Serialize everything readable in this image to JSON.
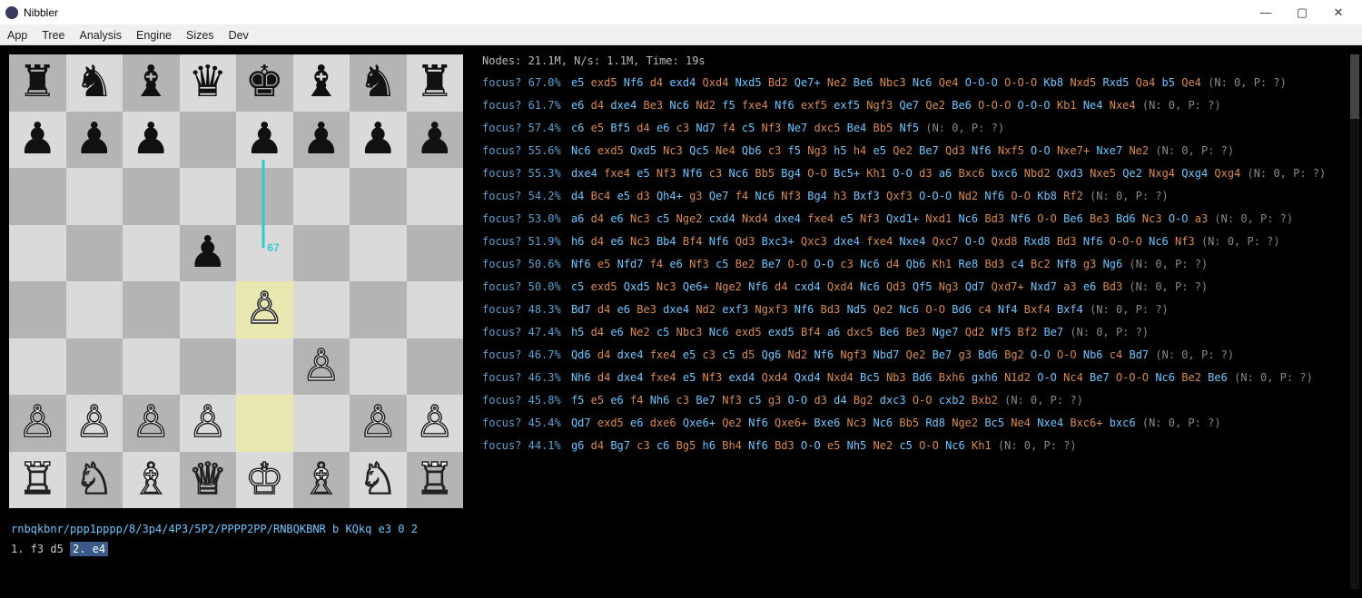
{
  "window": {
    "title": "Nibbler",
    "min_glyph": "—",
    "max_glyph": "▢",
    "close_glyph": "✕"
  },
  "menu": [
    "App",
    "Tree",
    "Analysis",
    "Engine",
    "Sizes",
    "Dev"
  ],
  "board": {
    "fen": "rnbqkbnr/ppp1pppp/8/3p4/4P3/5P2/PPPP2PP/RNBQKBNR b KQkq e3 0 2",
    "moves_prefix": "1. f3 d5 ",
    "current_move": "2. e4",
    "arrow_label": "67",
    "highlights": [
      "e4",
      "e2"
    ],
    "pieces": [
      {
        "sq": "a8",
        "g": "♜",
        "c": "black"
      },
      {
        "sq": "b8",
        "g": "♞",
        "c": "black"
      },
      {
        "sq": "c8",
        "g": "♝",
        "c": "black"
      },
      {
        "sq": "d8",
        "g": "♛",
        "c": "black"
      },
      {
        "sq": "e8",
        "g": "♚",
        "c": "black"
      },
      {
        "sq": "f8",
        "g": "♝",
        "c": "black"
      },
      {
        "sq": "g8",
        "g": "♞",
        "c": "black"
      },
      {
        "sq": "h8",
        "g": "♜",
        "c": "black"
      },
      {
        "sq": "a7",
        "g": "♟",
        "c": "black"
      },
      {
        "sq": "b7",
        "g": "♟",
        "c": "black"
      },
      {
        "sq": "c7",
        "g": "♟",
        "c": "black"
      },
      {
        "sq": "e7",
        "g": "♟",
        "c": "black"
      },
      {
        "sq": "f7",
        "g": "♟",
        "c": "black"
      },
      {
        "sq": "g7",
        "g": "♟",
        "c": "black"
      },
      {
        "sq": "h7",
        "g": "♟",
        "c": "black"
      },
      {
        "sq": "d5",
        "g": "♟",
        "c": "black"
      },
      {
        "sq": "e4",
        "g": "♙",
        "c": "white"
      },
      {
        "sq": "f3",
        "g": "♙",
        "c": "white"
      },
      {
        "sq": "a2",
        "g": "♙",
        "c": "white"
      },
      {
        "sq": "b2",
        "g": "♙",
        "c": "white"
      },
      {
        "sq": "c2",
        "g": "♙",
        "c": "white"
      },
      {
        "sq": "d2",
        "g": "♙",
        "c": "white"
      },
      {
        "sq": "g2",
        "g": "♙",
        "c": "white"
      },
      {
        "sq": "h2",
        "g": "♙",
        "c": "white"
      },
      {
        "sq": "a1",
        "g": "♖",
        "c": "white"
      },
      {
        "sq": "b1",
        "g": "♘",
        "c": "white"
      },
      {
        "sq": "c1",
        "g": "♗",
        "c": "white"
      },
      {
        "sq": "d1",
        "g": "♕",
        "c": "white"
      },
      {
        "sq": "e1",
        "g": "♔",
        "c": "white"
      },
      {
        "sq": "f1",
        "g": "♗",
        "c": "white"
      },
      {
        "sq": "g1",
        "g": "♘",
        "c": "white"
      },
      {
        "sq": "h1",
        "g": "♖",
        "c": "white"
      }
    ]
  },
  "status": "Nodes: 21.1M, N/s: 1.1M, Time: 19s",
  "label": "focus?",
  "lines": [
    {
      "pct": "67.0%",
      "moves": [
        "e5",
        "exd5",
        "Nf6",
        "d4",
        "exd4",
        "Qxd4",
        "Nxd5",
        "Bd2",
        "Qe7+",
        "Ne2",
        "Be6",
        "Nbc3",
        "Nc6",
        "Qe4",
        "O-O-O",
        "O-O-O",
        "Kb8",
        "Nxd5",
        "Rxd5",
        "Qa4",
        "b5",
        "Qe4"
      ],
      "np": "(N: 0, P: ?)"
    },
    {
      "pct": "61.7%",
      "moves": [
        "e6",
        "d4",
        "dxe4",
        "Be3",
        "Nc6",
        "Nd2",
        "f5",
        "fxe4",
        "Nf6",
        "exf5",
        "exf5",
        "Ngf3",
        "Qe7",
        "Qe2",
        "Be6",
        "O-O-O",
        "O-O-O",
        "Kb1",
        "Ne4",
        "Nxe4"
      ],
      "np": "(N: 0, P: ?)"
    },
    {
      "pct": "57.4%",
      "moves": [
        "c6",
        "e5",
        "Bf5",
        "d4",
        "e6",
        "c3",
        "Nd7",
        "f4",
        "c5",
        "Nf3",
        "Ne7",
        "dxc5",
        "Be4",
        "Bb5",
        "Nf5"
      ],
      "np": "(N: 0, P: ?)"
    },
    {
      "pct": "55.6%",
      "moves": [
        "Nc6",
        "exd5",
        "Qxd5",
        "Nc3",
        "Qc5",
        "Ne4",
        "Qb6",
        "c3",
        "f5",
        "Ng3",
        "h5",
        "h4",
        "e5",
        "Qe2",
        "Be7",
        "Qd3",
        "Nf6",
        "Nxf5",
        "O-O",
        "Nxe7+",
        "Nxe7",
        "Ne2"
      ],
      "np": "(N: 0, P: ?)"
    },
    {
      "pct": "55.3%",
      "moves": [
        "dxe4",
        "fxe4",
        "e5",
        "Nf3",
        "Nf6",
        "c3",
        "Nc6",
        "Bb5",
        "Bg4",
        "O-O",
        "Bc5+",
        "Kh1",
        "O-O",
        "d3",
        "a6",
        "Bxc6",
        "bxc6",
        "Nbd2",
        "Qxd3",
        "Nxe5",
        "Qe2",
        "Nxg4",
        "Qxg4",
        "Qxg4"
      ],
      "np": "(N: 0, P: ?)"
    },
    {
      "pct": "54.2%",
      "moves": [
        "d4",
        "Bc4",
        "e5",
        "d3",
        "Qh4+",
        "g3",
        "Qe7",
        "f4",
        "Nc6",
        "Nf3",
        "Bg4",
        "h3",
        "Bxf3",
        "Qxf3",
        "O-O-O",
        "Nd2",
        "Nf6",
        "O-O",
        "Kb8",
        "Rf2"
      ],
      "np": "(N: 0, P: ?)"
    },
    {
      "pct": "53.0%",
      "moves": [
        "a6",
        "d4",
        "e6",
        "Nc3",
        "c5",
        "Nge2",
        "cxd4",
        "Nxd4",
        "dxe4",
        "fxe4",
        "e5",
        "Nf3",
        "Qxd1+",
        "Nxd1",
        "Nc6",
        "Bd3",
        "Nf6",
        "O-O",
        "Be6",
        "Be3",
        "Bd6",
        "Nc3",
        "O-O",
        "a3"
      ],
      "np": "(N: 0, P: ?)"
    },
    {
      "pct": "51.9%",
      "moves": [
        "h6",
        "d4",
        "e6",
        "Nc3",
        "Bb4",
        "Bf4",
        "Nf6",
        "Qd3",
        "Bxc3+",
        "Qxc3",
        "dxe4",
        "fxe4",
        "Nxe4",
        "Qxc7",
        "O-O",
        "Qxd8",
        "Rxd8",
        "Bd3",
        "Nf6",
        "O-O-O",
        "Nc6",
        "Nf3"
      ],
      "np": "(N: 0, P: ?)"
    },
    {
      "pct": "50.6%",
      "moves": [
        "Nf6",
        "e5",
        "Nfd7",
        "f4",
        "e6",
        "Nf3",
        "c5",
        "Be2",
        "Be7",
        "O-O",
        "O-O",
        "c3",
        "Nc6",
        "d4",
        "Qb6",
        "Kh1",
        "Re8",
        "Bd3",
        "c4",
        "Bc2",
        "Nf8",
        "g3",
        "Ng6"
      ],
      "np": "(N: 0, P: ?)"
    },
    {
      "pct": "50.0%",
      "moves": [
        "c5",
        "exd5",
        "Qxd5",
        "Nc3",
        "Qe6+",
        "Nge2",
        "Nf6",
        "d4",
        "cxd4",
        "Qxd4",
        "Nc6",
        "Qd3",
        "Qf5",
        "Ng3",
        "Qd7",
        "Qxd7+",
        "Nxd7",
        "a3",
        "e6",
        "Bd3"
      ],
      "np": "(N: 0, P: ?)"
    },
    {
      "pct": "48.3%",
      "moves": [
        "Bd7",
        "d4",
        "e6",
        "Be3",
        "dxe4",
        "Nd2",
        "exf3",
        "Ngxf3",
        "Nf6",
        "Bd3",
        "Nd5",
        "Qe2",
        "Nc6",
        "O-O",
        "Bd6",
        "c4",
        "Nf4",
        "Bxf4",
        "Bxf4"
      ],
      "np": "(N: 0, P: ?)"
    },
    {
      "pct": "47.4%",
      "moves": [
        "h5",
        "d4",
        "e6",
        "Ne2",
        "c5",
        "Nbc3",
        "Nc6",
        "exd5",
        "exd5",
        "Bf4",
        "a6",
        "dxc5",
        "Be6",
        "Be3",
        "Nge7",
        "Qd2",
        "Nf5",
        "Bf2",
        "Be7"
      ],
      "np": "(N: 0, P: ?)"
    },
    {
      "pct": "46.7%",
      "moves": [
        "Qd6",
        "d4",
        "dxe4",
        "fxe4",
        "e5",
        "c3",
        "c5",
        "d5",
        "Qg6",
        "Nd2",
        "Nf6",
        "Ngf3",
        "Nbd7",
        "Qe2",
        "Be7",
        "g3",
        "Bd6",
        "Bg2",
        "O-O",
        "O-O",
        "Nb6",
        "c4",
        "Bd7"
      ],
      "np": "(N: 0, P: ?)"
    },
    {
      "pct": "46.3%",
      "moves": [
        "Nh6",
        "d4",
        "dxe4",
        "fxe4",
        "e5",
        "Nf3",
        "exd4",
        "Qxd4",
        "Qxd4",
        "Nxd4",
        "Bc5",
        "Nb3",
        "Bd6",
        "Bxh6",
        "gxh6",
        "N1d2",
        "O-O",
        "Nc4",
        "Be7",
        "O-O-O",
        "Nc6",
        "Be2",
        "Be6"
      ],
      "np": "(N: 0, P: ?)"
    },
    {
      "pct": "45.8%",
      "moves": [
        "f5",
        "e5",
        "e6",
        "f4",
        "Nh6",
        "c3",
        "Be7",
        "Nf3",
        "c5",
        "g3",
        "O-O",
        "d3",
        "d4",
        "Bg2",
        "dxc3",
        "O-O",
        "cxb2",
        "Bxb2"
      ],
      "np": "(N: 0, P: ?)"
    },
    {
      "pct": "45.4%",
      "moves": [
        "Qd7",
        "exd5",
        "e6",
        "dxe6",
        "Qxe6+",
        "Qe2",
        "Nf6",
        "Qxe6+",
        "Bxe6",
        "Nc3",
        "Nc6",
        "Bb5",
        "Rd8",
        "Nge2",
        "Bc5",
        "Ne4",
        "Nxe4",
        "Bxc6+",
        "bxc6"
      ],
      "np": "(N: 0, P: ?)"
    },
    {
      "pct": "44.1%",
      "moves": [
        "g6",
        "d4",
        "Bg7",
        "c3",
        "c6",
        "Bg5",
        "h6",
        "Bh4",
        "Nf6",
        "Bd3",
        "O-O",
        "e5",
        "Nh5",
        "Ne2",
        "c5",
        "O-O",
        "Nc6",
        "Kh1"
      ],
      "np": "(N: 0, P: ?)"
    }
  ]
}
